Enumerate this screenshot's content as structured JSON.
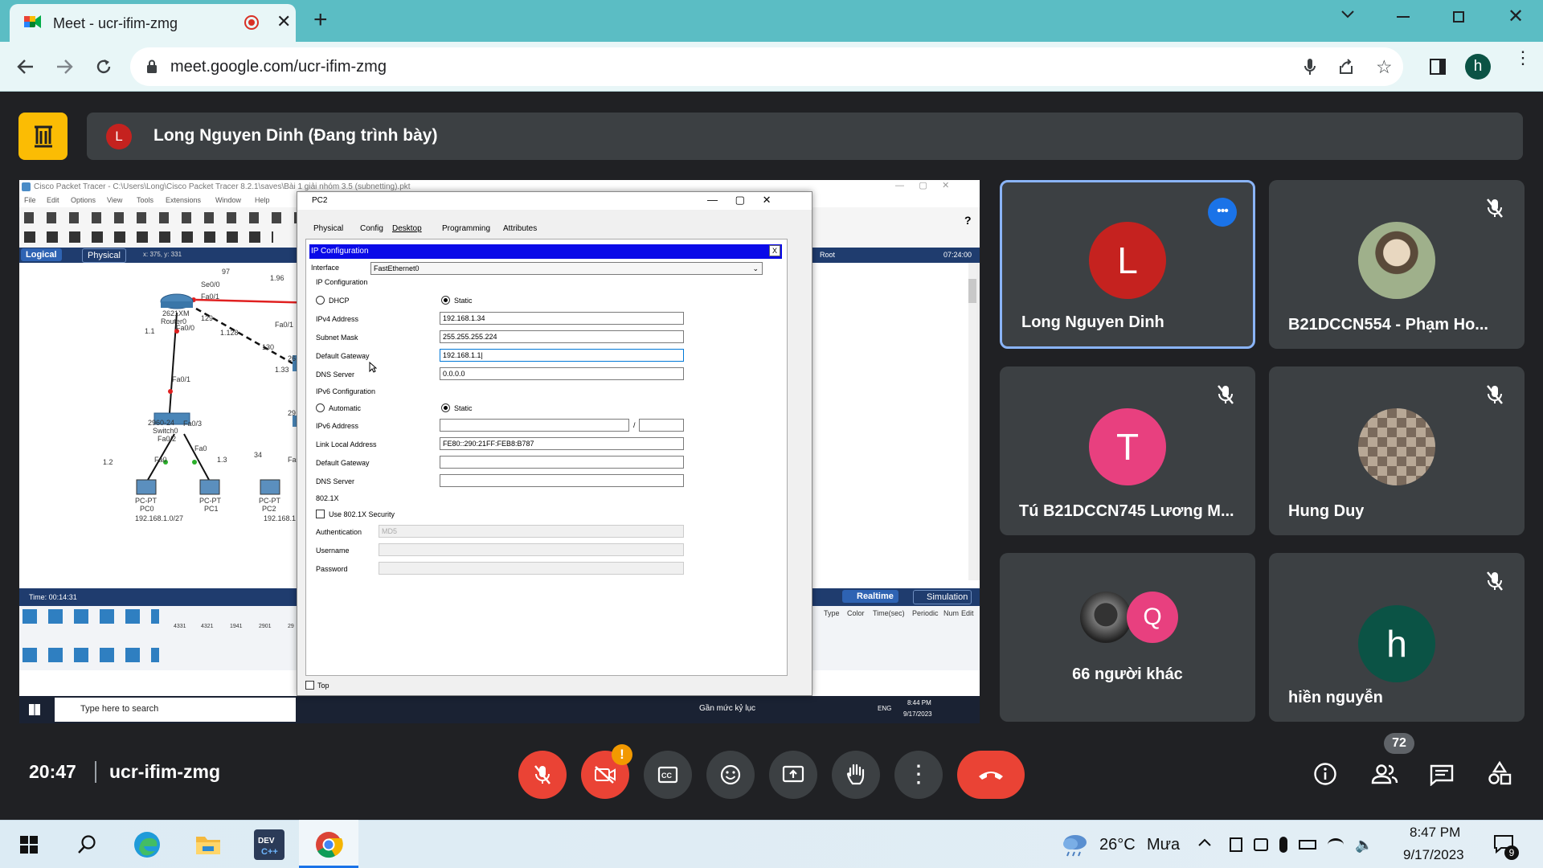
{
  "browser": {
    "tab_title": "Meet - ucr-ifim-zmg",
    "url": "meet.google.com/ucr-ifim-zmg",
    "profile_initial": "h"
  },
  "presenter": {
    "initial": "L",
    "text": "Long Nguyen Dinh (Đang trình bày)"
  },
  "shared_screen": {
    "pt_title": "Cisco Packet Tracer - C:\\Users\\Long\\Cisco Packet Tracer 8.2.1\\saves\\Bài 1 giải nhóm 3.5 (subnetting).pkt",
    "menu": [
      "File",
      "Edit",
      "Options",
      "View",
      "Tools",
      "Extensions",
      "Window",
      "Help"
    ],
    "logical_label": "Logical",
    "physical_label": "Physical",
    "coords": "x: 375, y: 331",
    "root_label": "Root",
    "clock": "07:24:00",
    "time_label": "Time: 00:14:31",
    "realtime_label": "Realtime",
    "simulation_label": "Simulation",
    "event_headers": [
      "Type",
      "Color",
      "Time(sec)",
      "Periodic",
      "Num",
      "Edit"
    ],
    "device_models": [
      "4331",
      "4321",
      "1941",
      "2901",
      "29"
    ],
    "topology_labels": [
      "97",
      "1.96",
      "Se0/0",
      "Fa0/1",
      "2621XM",
      "Router0",
      "129",
      "Fa0/0",
      "1.1",
      "1.128",
      "130",
      "Fa0/1",
      "1.33",
      "Fa0/1",
      "2960-24",
      "Switch0",
      "Fa0/3",
      "Fa0/2",
      "Fa0",
      "Fa0",
      "1.2",
      "1.3",
      "34",
      "PC-PT",
      "PC0",
      "PC-PT",
      "PC1",
      "PC-PT",
      "PC2",
      "192.168.1.0/27",
      "192.168.1",
      "26",
      "29",
      "Fa0"
    ],
    "dialog": {
      "title": "PC2",
      "tabs": [
        "Physical",
        "Config",
        "Desktop",
        "Programming",
        "Attributes"
      ],
      "active_tab": "Desktop",
      "panel_title": "IP Configuration",
      "close_x": "X",
      "interface_label": "Interface",
      "interface_value": "FastEthernet0",
      "ipv4": {
        "section": "IP Configuration",
        "dhcp": "DHCP",
        "static": "Static",
        "rows": [
          {
            "label": "IPv4 Address",
            "value": "192.168.1.34"
          },
          {
            "label": "Subnet Mask",
            "value": "255.255.255.224"
          },
          {
            "label": "Default Gateway",
            "value": "192.168.1.1|"
          },
          {
            "label": "DNS Server",
            "value": "0.0.0.0"
          }
        ]
      },
      "ipv6": {
        "section": "IPv6 Configuration",
        "automatic": "Automatic",
        "static": "Static",
        "slash": "/",
        "rows": [
          {
            "label": "IPv6 Address",
            "value": ""
          },
          {
            "label": "Link Local Address",
            "value": "FE80::290:21FF:FEB8:B787"
          },
          {
            "label": "Default Gateway",
            "value": ""
          },
          {
            "label": "DNS Server",
            "value": ""
          }
        ]
      },
      "dot1x": {
        "section": "802.1X",
        "checkbox": "Use 802.1X Security",
        "auth_label": "Authentication",
        "auth_value": "MD5",
        "username_label": "Username",
        "password_label": "Password"
      },
      "top_checkbox": "Top"
    },
    "taskbar": {
      "search_placeholder": "Type here to search",
      "weather": "Gần mức kỷ lục",
      "lang": "ENG",
      "time": "8:44 PM",
      "date": "9/17/2023"
    }
  },
  "participants": [
    {
      "name": "Long Nguyen Dinh",
      "initial": "L",
      "color": "#c5221f",
      "muted": false,
      "highlighted": true
    },
    {
      "name": "B21DCCN554 - Phạm Ho...",
      "initial": "",
      "color": "#8a9a7b",
      "muted": true,
      "photo": true
    },
    {
      "name": "Tú B21DCCN745 Lương M...",
      "initial": "T",
      "color": "#e8407f",
      "muted": true
    },
    {
      "name": "Hung Duy",
      "initial": "",
      "color": "#6b6b6b",
      "muted": true,
      "photo": true
    },
    {
      "name": "66 người khác",
      "initial": "Q",
      "color": "#e8407f",
      "muted": false,
      "others": true
    },
    {
      "name": "hiền nguyễn",
      "initial": "h",
      "color": "#0b5345",
      "muted": true
    }
  ],
  "meeting": {
    "time": "20:47",
    "code": "ucr-ifim-zmg",
    "participant_count": "72",
    "camera_alert": "!"
  },
  "windows_taskbar": {
    "temperature": "26°C",
    "weather": "Mưa",
    "time": "8:47 PM",
    "date": "9/17/2023",
    "notifications": "9"
  },
  "colors": {
    "chrome_teal": "#5bbdc4",
    "meet_bg": "#202124",
    "tile_bg": "#3c4043",
    "end_call_red": "#ea4335",
    "highlight_blue": "#8ab4f8",
    "presenter_exit_yellow": "#fbbc04"
  }
}
